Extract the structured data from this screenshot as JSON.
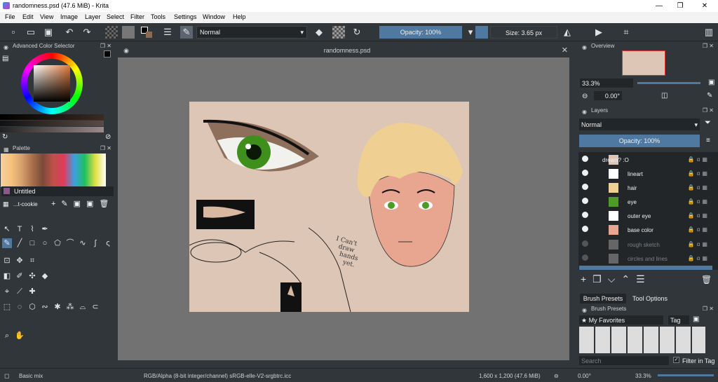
{
  "window": {
    "title": "randomness.psd (47.6 MiB) - Krita",
    "minimize": "—",
    "maximize": "❐",
    "close": "✕"
  },
  "menu": [
    "File",
    "Edit",
    "View",
    "Image",
    "Layer",
    "Select",
    "Filter",
    "Tools",
    "Settings",
    "Window",
    "Help"
  ],
  "toolbar": {
    "blend_mode": "Normal",
    "opacity": "Opacity: 100%",
    "size": "Size: 3.65 px"
  },
  "left": {
    "color_selector": "Advanced Color Selector",
    "palette_title": "Palette",
    "palette_name": "Untitled",
    "brush_tip": "...t-cookie"
  },
  "document": {
    "tab_title": "randomness.psd",
    "close": "✕",
    "handwriting": [
      "I Can't",
      "draw",
      "hands",
      "yet."
    ]
  },
  "overview": {
    "title": "Overview",
    "zoom": "33.3%",
    "rotation": "0.00°"
  },
  "layers": {
    "title": "Layers",
    "blend_mode": "Normal",
    "opacity": "Opacity:  100%",
    "items": [
      {
        "name": "dream? :O",
        "visible": true
      },
      {
        "name": "lineart",
        "visible": true
      },
      {
        "name": "hair",
        "visible": true
      },
      {
        "name": "eye",
        "visible": true
      },
      {
        "name": "outer eye",
        "visible": true
      },
      {
        "name": "base color",
        "visible": true
      },
      {
        "name": "rough sketch",
        "visible": false
      },
      {
        "name": "circles and lines",
        "visible": false
      }
    ]
  },
  "presets": {
    "tab1": "Brush Presets",
    "tab2": "Tool Options",
    "title": "Brush Presets",
    "tag_filter": "★ My Favorites",
    "tag_label": "Tag",
    "search_placeholder": "Search",
    "filter_label": "Filter in Tag"
  },
  "status": {
    "preset": "Basic mix",
    "color_info": "RGB/Alpha (8-bit integer/channel)  sRGB-elle-V2-srgbtrc.icc",
    "image_info": "1,600 x 1,200 (47.6 MiB)",
    "rotation": "0.00°",
    "zoom": "33.3%"
  }
}
